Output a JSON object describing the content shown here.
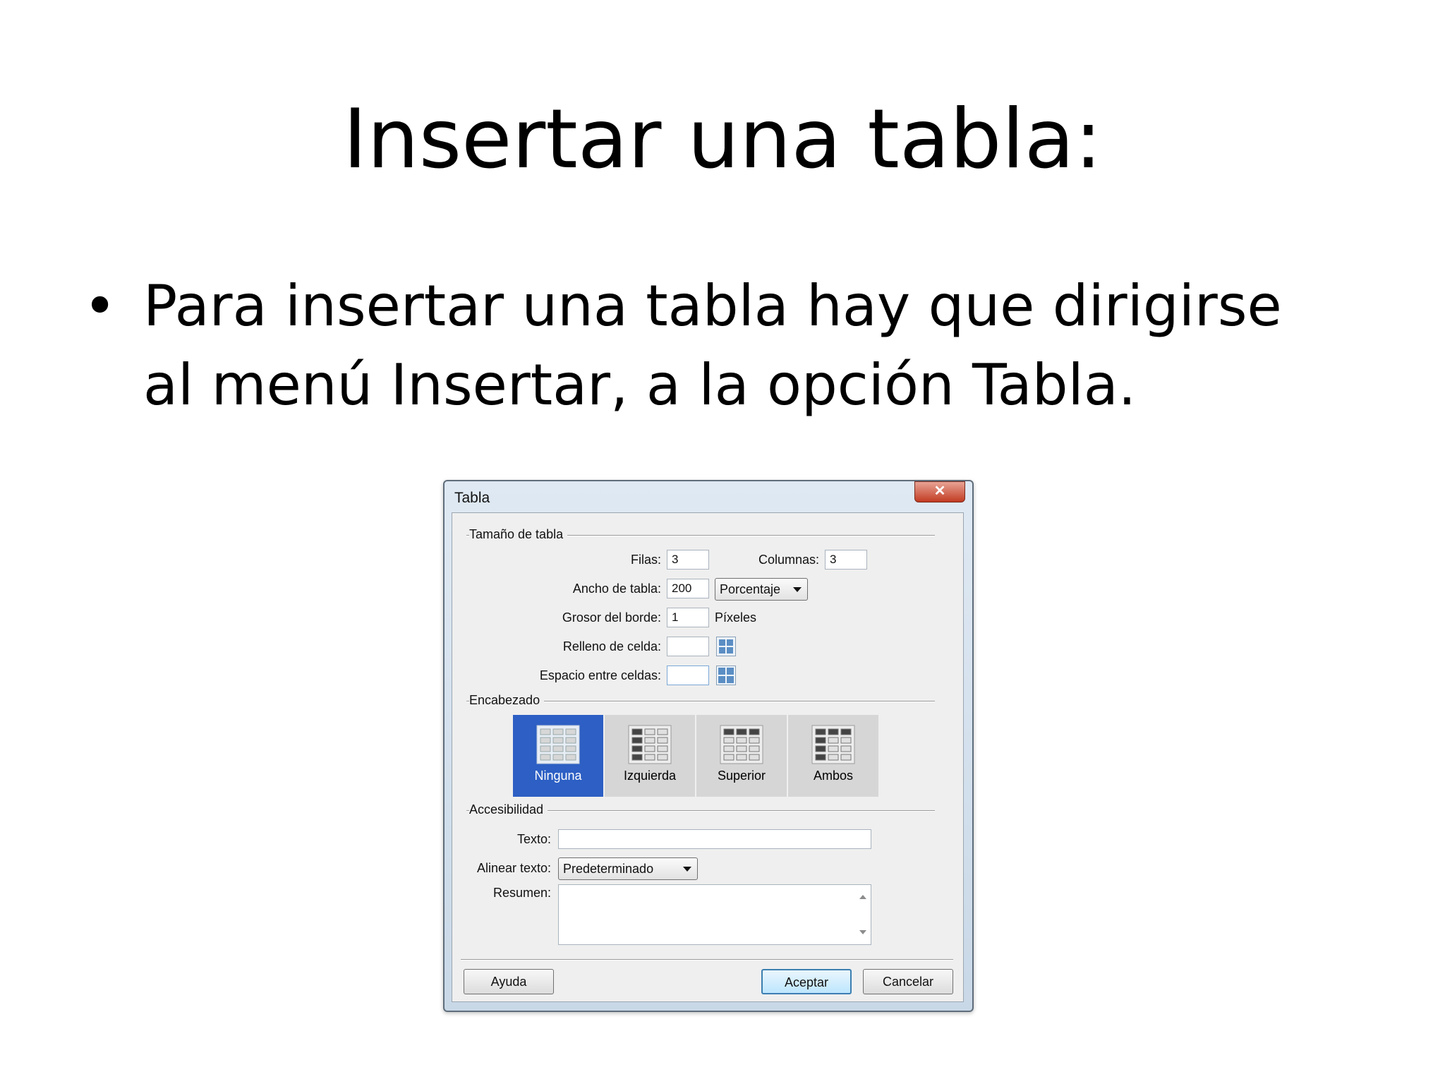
{
  "slide": {
    "title": "Insertar una tabla:",
    "bullet_mark": "•",
    "bullet_text": "Para insertar una tabla hay que dirigirse al menú Insertar, a la opción Tabla."
  },
  "dialog": {
    "title": "Tabla",
    "close_glyph": "✕",
    "table_size": {
      "group_label": "Tamaño de tabla",
      "rows_label": "Filas:",
      "rows_value": "3",
      "cols_label": "Columnas:",
      "cols_value": "3",
      "width_label": "Ancho de tabla:",
      "width_value": "200",
      "width_unit_selected": "Porcentaje",
      "border_label": "Grosor del borde:",
      "border_value": "1",
      "border_unit": "Píxeles",
      "padding_label": "Relleno de celda:",
      "padding_value": "",
      "spacing_label": "Espacio entre celdas:",
      "spacing_value": ""
    },
    "header": {
      "group_label": "Encabezado",
      "options": [
        "Ninguna",
        "Izquierda",
        "Superior",
        "Ambos"
      ],
      "selected": "Ninguna"
    },
    "accessibility": {
      "group_label": "Accesibilidad",
      "text_label": "Texto:",
      "text_value": "",
      "align_label": "Alinear texto:",
      "align_selected": "Predeterminado",
      "summary_label": "Resumen:",
      "summary_value": ""
    },
    "buttons": {
      "help": "Ayuda",
      "ok": "Aceptar",
      "cancel": "Cancelar"
    },
    "colors": {
      "selected_option": "#2d5fc4",
      "close_button": "#c23b22"
    }
  }
}
